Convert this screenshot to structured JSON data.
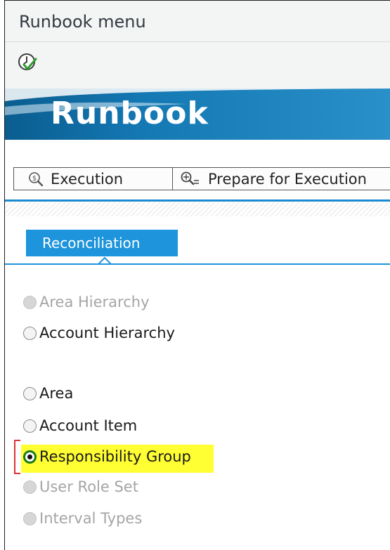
{
  "window": {
    "title": "Runbook menu"
  },
  "toolbar": {
    "execute_icon": "execute-clock-check-icon"
  },
  "banner": {
    "title": "Runbook"
  },
  "buttons": {
    "execution": {
      "label": "Execution",
      "icon": "magnifier-dollar-icon"
    },
    "prepare": {
      "label": "Prepare for Execution",
      "icon": "magnifier-settings-icon"
    }
  },
  "tabs": [
    {
      "label": "Reconciliation",
      "active": true
    }
  ],
  "options": [
    {
      "label": "Area Hierarchy",
      "enabled": false,
      "selected": false
    },
    {
      "label": "Account Hierarchy",
      "enabled": true,
      "selected": false
    },
    {
      "label": "Area",
      "enabled": true,
      "selected": false
    },
    {
      "label": "Account Item",
      "enabled": true,
      "selected": false
    },
    {
      "label": "Responsibility Group",
      "enabled": true,
      "selected": true
    },
    {
      "label": "User Role Set",
      "enabled": false,
      "selected": false
    },
    {
      "label": "Interval Types",
      "enabled": false,
      "selected": false
    }
  ],
  "colors": {
    "accent": "#1d94db",
    "banner_dark": "#0a5d8f",
    "highlight": "#ffff33",
    "selected_radio": "#1a7a1a",
    "focus_marker": "#dd3333"
  }
}
